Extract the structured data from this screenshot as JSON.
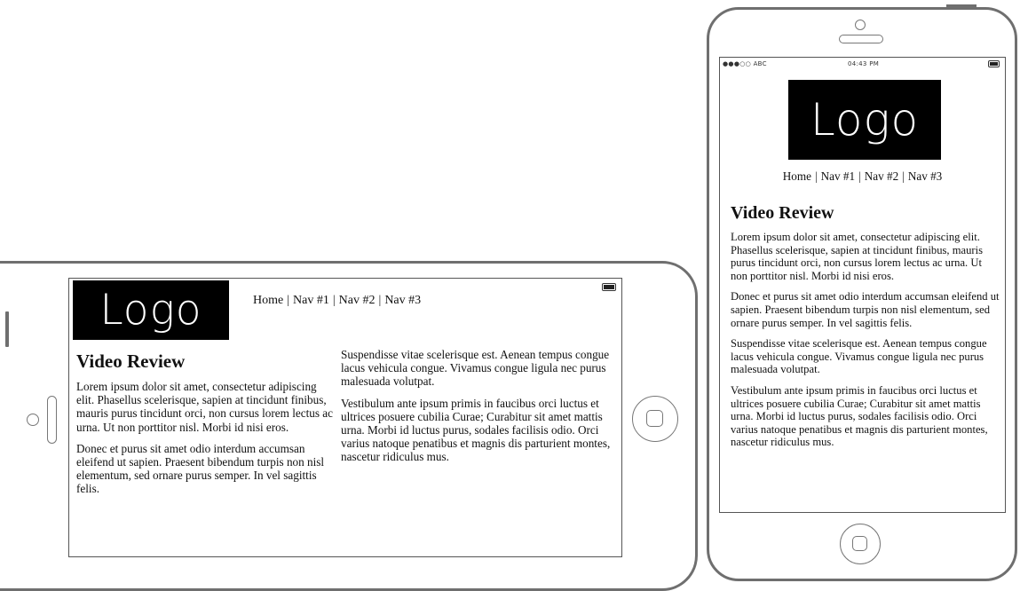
{
  "logo_text": "Logo",
  "nav": {
    "home": "Home",
    "nav1": "Nav #1",
    "nav2": "Nav #2",
    "nav3": "Nav #3",
    "separator": "|"
  },
  "status_bar": {
    "carrier": "●●●○○ ABC",
    "time": "04:43 PM"
  },
  "article": {
    "title": "Video Review",
    "paragraphs": [
      "Lorem ipsum dolor sit amet, consectetur adipiscing elit. Phasellus scelerisque, sapien at tincidunt finibus, mauris purus tincidunt orci, non cursus lorem lectus ac urna. Ut non porttitor nisl. Morbi id nisi eros.",
      "Donec et purus sit amet odio interdum accumsan eleifend ut sapien. Praesent bibendum turpis non nisl elementum, sed ornare purus semper. In vel sagittis felis.",
      "Suspendisse vitae scelerisque est. Aenean tempus congue lacus vehicula congue. Vivamus congue ligula nec purus malesuada volutpat.",
      "Vestibulum ante ipsum primis in faucibus orci luctus et ultrices posuere cubilia Curae; Curabitur sit amet mattis urna. Morbi id luctus purus, sodales facilisis odio. Orci varius natoque penatibus et magnis dis parturient montes, nascetur ridiculus mus."
    ]
  },
  "colors": {
    "device_outline": "#6f6f6f",
    "logo_background": "#000000",
    "logo_text": "#ffffff"
  }
}
